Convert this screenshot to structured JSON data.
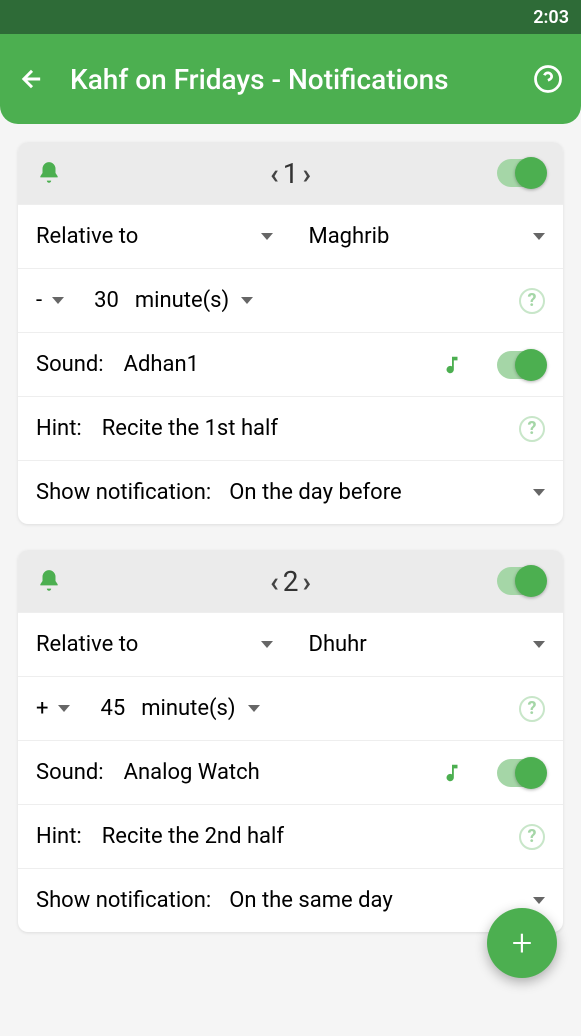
{
  "status_bar": {
    "time": "2:03"
  },
  "header": {
    "title": "Kahf on Fridays - Notifications"
  },
  "labels": {
    "relative_to": "Relative to",
    "sound": "Sound:",
    "hint": "Hint:",
    "show_notification": "Show notification:",
    "minutes": "minute(s)"
  },
  "cards": [
    {
      "index": "1",
      "enabled": true,
      "relative_to": "Maghrib",
      "sign": "-",
      "offset": "30",
      "sound": "Adhan1",
      "sound_enabled": true,
      "hint": "Recite the 1st half",
      "show_on": "On the day before"
    },
    {
      "index": "2",
      "enabled": true,
      "relative_to": "Dhuhr",
      "sign": "+",
      "offset": "45",
      "sound": "Analog Watch",
      "sound_enabled": true,
      "hint": "Recite the 2nd half",
      "show_on": "On the same day"
    }
  ]
}
